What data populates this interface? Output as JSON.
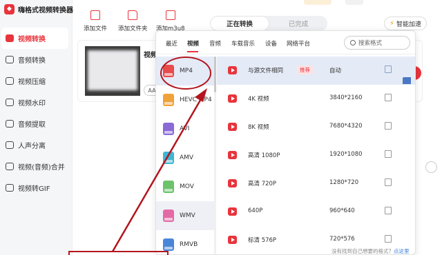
{
  "app": {
    "title": "嗨格式视频转换器",
    "logo_glyph": "◆"
  },
  "sidebar": {
    "items": [
      {
        "label": "视频转换",
        "active": true
      },
      {
        "label": "音频转换"
      },
      {
        "label": "视频压缩"
      },
      {
        "label": "视频水印"
      },
      {
        "label": "音频提取"
      },
      {
        "label": "人声分离"
      },
      {
        "label": "视频(音频)合并"
      },
      {
        "label": "视频转GIF"
      }
    ]
  },
  "toolbar": {
    "add_file": "添加文件",
    "add_folder": "添加文件夹",
    "add_m3u8": "添加m3u8"
  },
  "tabs": {
    "converting": "正在转换",
    "done": "已完成"
  },
  "speed_button": "智能加速",
  "file_card": {
    "title": "视频",
    "pill": "AA"
  },
  "format_panel": {
    "categories": [
      "最近",
      "视频",
      "音频",
      "车载音乐",
      "设备",
      "网络平台"
    ],
    "active_category": "视频",
    "search_placeholder": "搜索格式",
    "formats": [
      {
        "name": "MP4",
        "color": "#e84b4b",
        "selected": true
      },
      {
        "name": "HEVC MP4",
        "color": "#f0a23a"
      },
      {
        "name": "AVI",
        "color": "#8a6ad6"
      },
      {
        "name": "AMV",
        "color": "#3fb6d4"
      },
      {
        "name": "MOV",
        "color": "#6cc36a"
      },
      {
        "name": "WMV",
        "color": "#e46aa6"
      },
      {
        "name": "RMVB",
        "color": "#4a86d8"
      }
    ],
    "resolutions": [
      {
        "name": "与源文件相同",
        "tag": "推荐",
        "value": "自动",
        "selected": true
      },
      {
        "name": "4K 视频",
        "value": "3840*2160"
      },
      {
        "name": "8K 视频",
        "value": "7680*4320"
      },
      {
        "name": "高清 1080P",
        "value": "1920*1080"
      },
      {
        "name": "高清 720P",
        "value": "1280*720"
      },
      {
        "name": "640P",
        "value": "960*640"
      },
      {
        "name": "标清 576P",
        "value": "720*576"
      }
    ],
    "footer_text": "没有找到自己想要的格式？",
    "footer_link": "点这里"
  },
  "colors": {
    "accent": "#e8343c",
    "selected_row": "#e4eaf6",
    "annotation": "#b3141d"
  }
}
